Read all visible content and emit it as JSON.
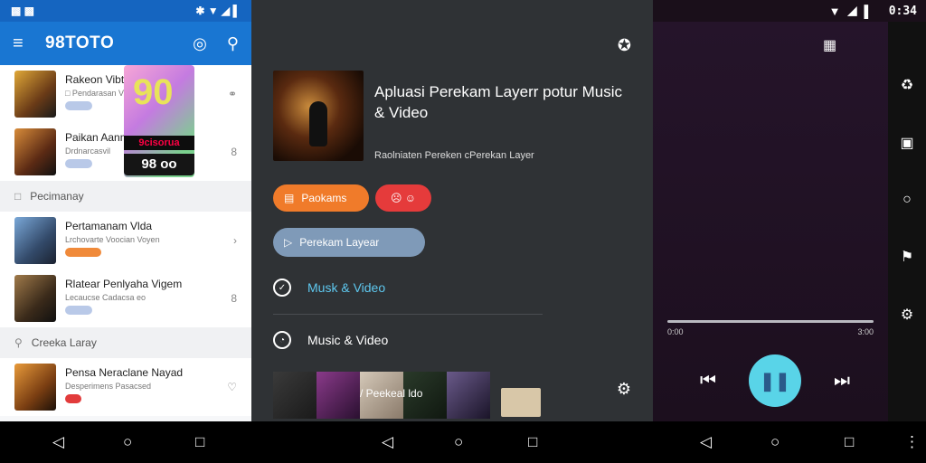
{
  "status": {
    "left_icons": "▩ ▩",
    "right_icons_left": "✱ ▼ ◢ ▌",
    "time": "0:34"
  },
  "left": {
    "app_title": "98TOTO",
    "rows": [
      {
        "title": "Rakeon Vibt",
        "sub": "□ Pendarasan Vio",
        "end": "⚭"
      },
      {
        "title": "Paikan Aanm",
        "sub": "Drdnarcasvil",
        "end": "8"
      },
      {
        "title": "Pertamanam Vlda",
        "sub": "Lrchovarte Voocian Voyen",
        "end": "›"
      },
      {
        "title": "Rlatear Penlyaha Vigem",
        "sub": "Lecaucse Cadacsa eo",
        "end": "8"
      }
    ],
    "sections": [
      "Pecimanay",
      "Creeka Laray"
    ],
    "last_row": {
      "title": "Pensa Neraclane Nayad",
      "sub": "Desperimens Pasacsed",
      "end": "♡"
    },
    "promo": {
      "number": "90",
      "brand": "9cisorua",
      "sub": "98 oo"
    }
  },
  "mid": {
    "title": "Apluasi Perekam Layerr potur Music & Video",
    "subtitle": "Raolniaten Pereken cPerekan Layer",
    "btn_primary": "Paokams",
    "btn_secondary": "☹ ☺",
    "pill": "Perekam Layear",
    "item1": "Musk & Video",
    "item2": "Music & Video",
    "strip_label": "/ Peekeal ldo"
  },
  "player": {
    "time_start": "0:00",
    "time_end": "3:00"
  }
}
